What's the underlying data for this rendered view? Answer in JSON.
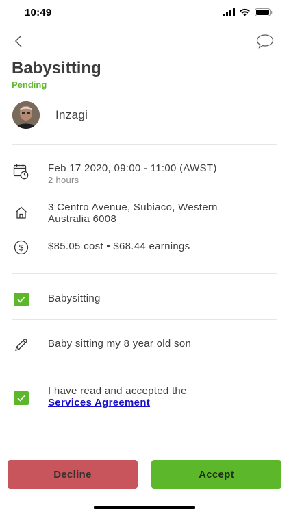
{
  "status_bar": {
    "time": "10:49"
  },
  "header": {
    "title": "Babysitting",
    "status": "Pending",
    "status_color": "#5cb82a"
  },
  "user": {
    "name": "Inzagi"
  },
  "details": {
    "datetime": "Feb 17 2020, 09:00 - 11:00 (AWST)",
    "duration": "2 hours",
    "address_line1": "3 Centro Avenue, Subiaco, Western",
    "address_line2": "Australia 6008",
    "cost": "$85.05 cost • $68.44 earnings"
  },
  "service": {
    "label": "Babysitting",
    "checked": true
  },
  "note": {
    "text": "Baby sitting my 8 year old son"
  },
  "agreement": {
    "text": "I have read and accepted the",
    "link_text": "Services Agreement",
    "checked": true
  },
  "actions": {
    "decline_label": "Decline",
    "accept_label": "Accept",
    "decline_color": "#c8555b",
    "accept_color": "#5cb82a"
  }
}
